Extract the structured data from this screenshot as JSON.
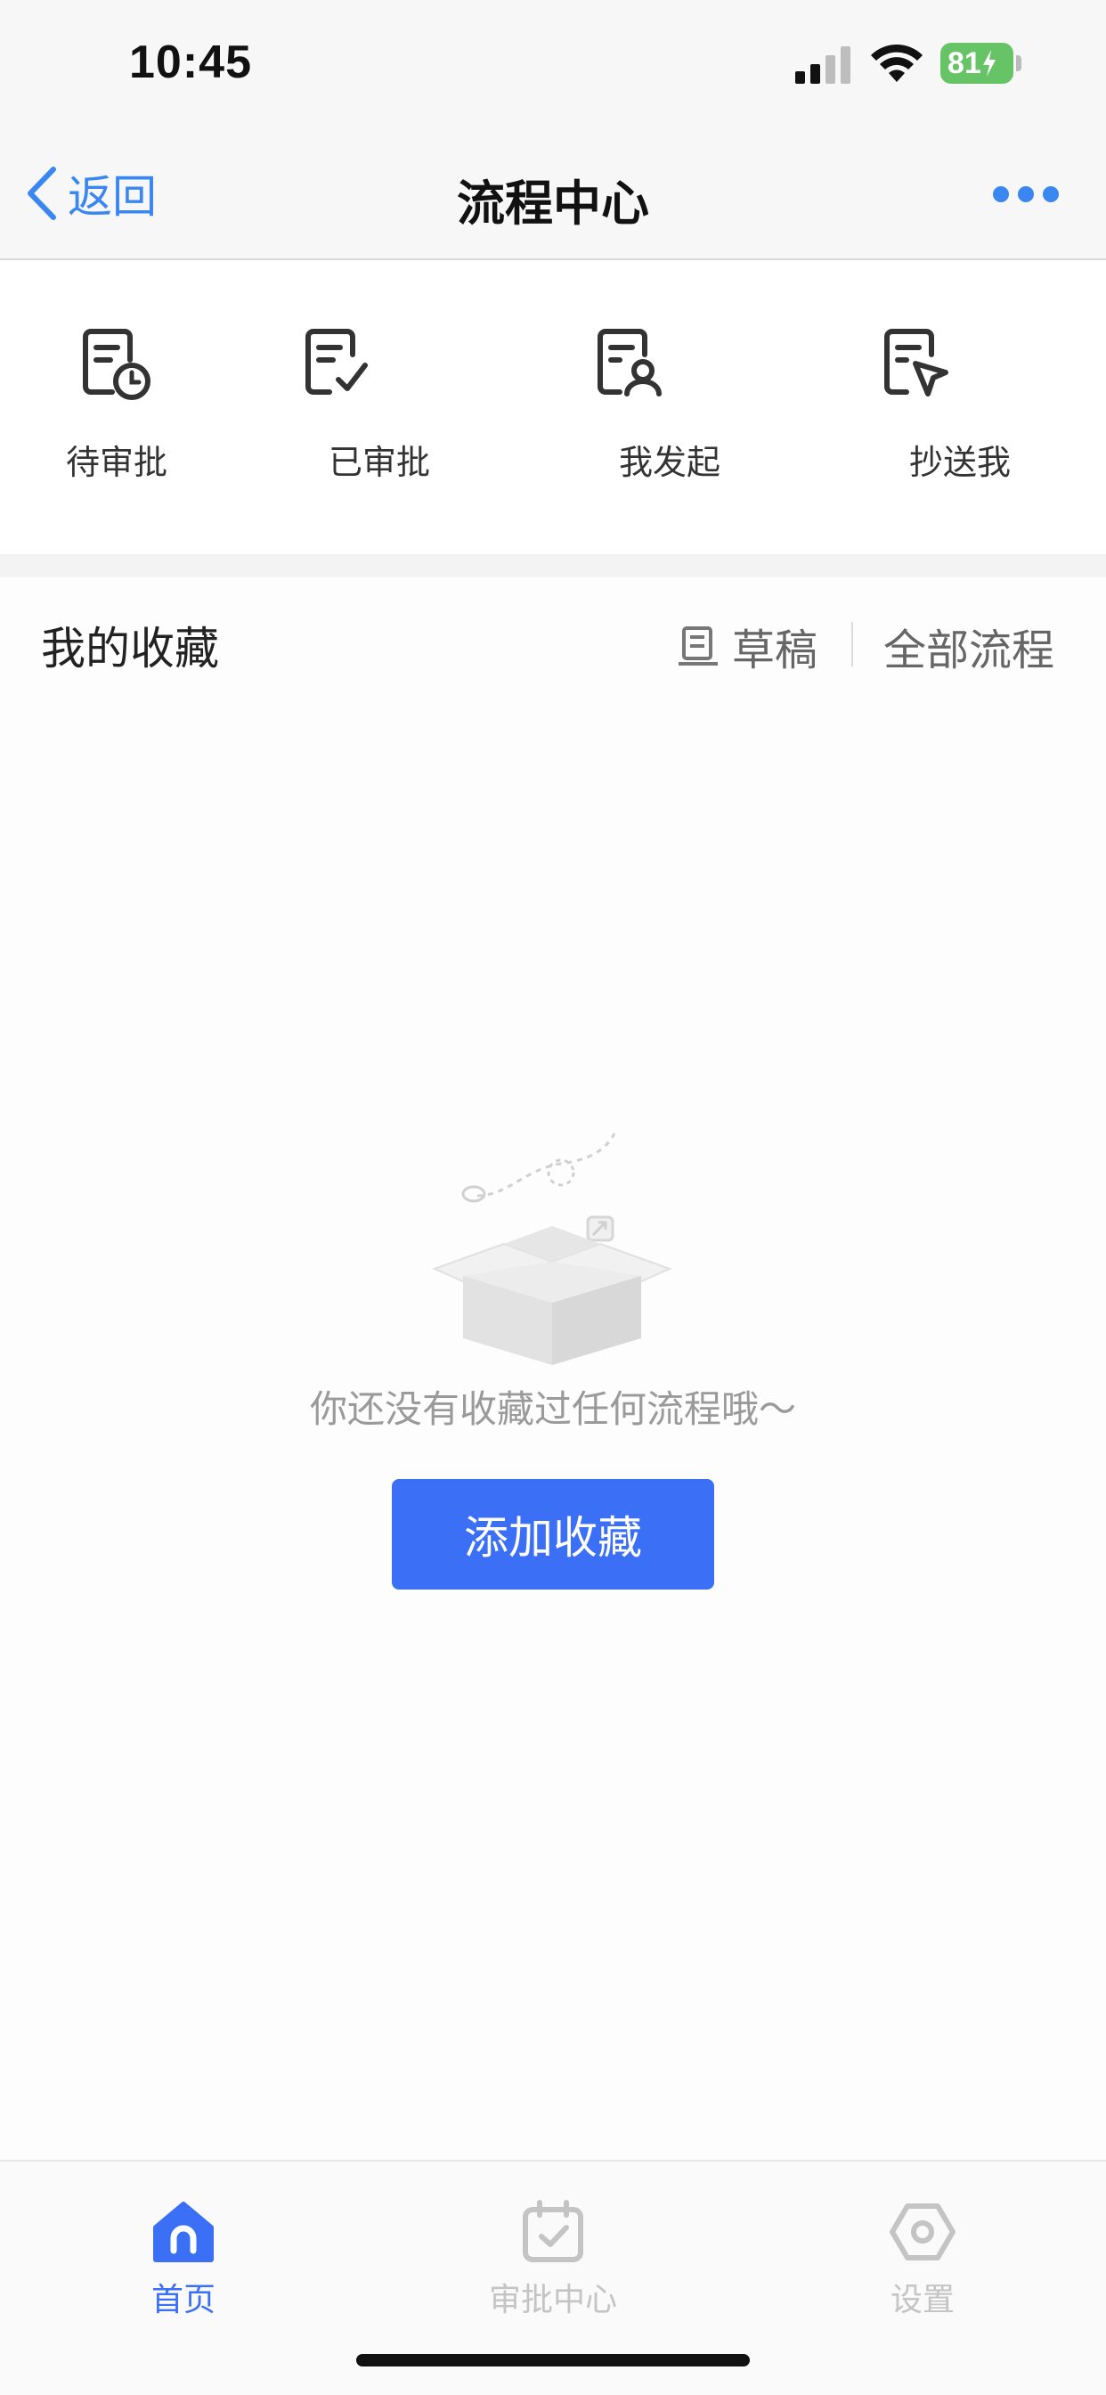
{
  "status_bar": {
    "time": "10:45",
    "battery": "81"
  },
  "nav": {
    "back_label": "返回",
    "title": "流程中心"
  },
  "quick_actions": [
    {
      "label": "待审批",
      "icon": "pending-approval-icon"
    },
    {
      "label": "已审批",
      "icon": "approved-icon"
    },
    {
      "label": "我发起",
      "icon": "initiated-icon"
    },
    {
      "label": "抄送我",
      "icon": "cc-me-icon"
    }
  ],
  "favorites": {
    "title": "我的收藏",
    "drafts_label": "草稿",
    "all_process_label": "全部流程",
    "empty_text": "你还没有收藏过任何流程哦～",
    "add_button_label": "添加收藏"
  },
  "tabs": [
    {
      "label": "首页",
      "active": true
    },
    {
      "label": "审批中心",
      "active": false
    },
    {
      "label": "设置",
      "active": false
    }
  ],
  "colors": {
    "accent": "#3b6ff5",
    "link": "#3b87f1",
    "tab_inactive": "#c4c4c4",
    "battery": "#66c366"
  }
}
